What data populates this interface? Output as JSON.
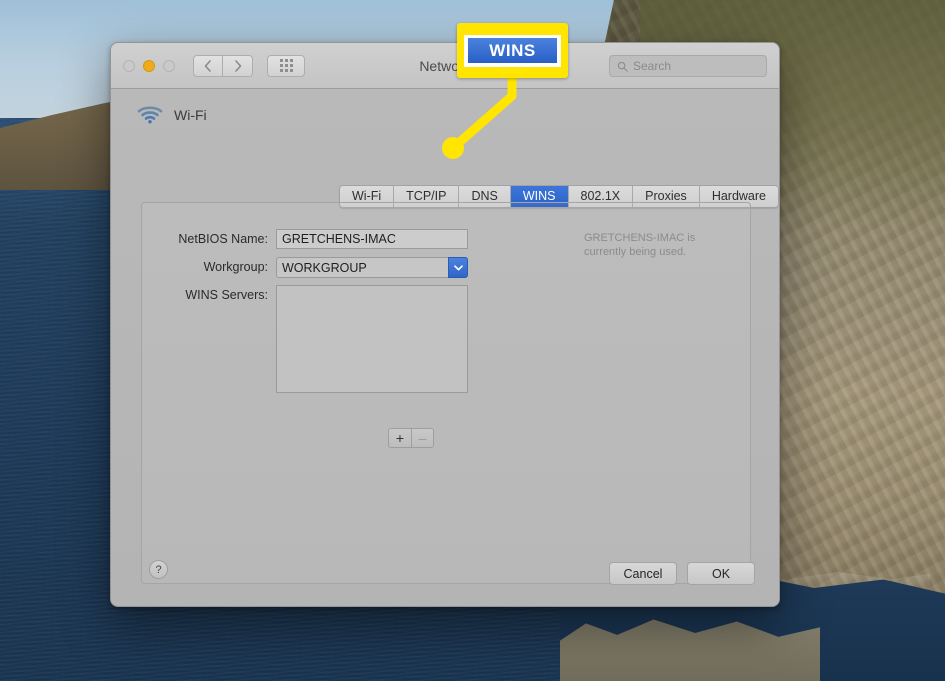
{
  "desktop": {
    "name": "macos-desktop-wallpaper"
  },
  "window": {
    "title": "Network",
    "traffic_lights": [
      {
        "name": "close",
        "state": "inactive",
        "color": "#c9c9c9"
      },
      {
        "name": "minimize",
        "state": "active",
        "color": "#f0ab1d"
      },
      {
        "name": "zoom",
        "state": "inactive",
        "color": "#c9c9c9"
      }
    ],
    "nav": {
      "back_label": "‹",
      "forward_label": "›"
    },
    "search": {
      "placeholder": "Search",
      "value": ""
    },
    "device": {
      "label": "Wi-Fi",
      "icon": "wifi-icon"
    }
  },
  "tabs": [
    {
      "label": "Wi-Fi",
      "active": false
    },
    {
      "label": "TCP/IP",
      "active": false
    },
    {
      "label": "DNS",
      "active": false
    },
    {
      "label": "WINS",
      "active": true
    },
    {
      "label": "802.1X",
      "active": false
    },
    {
      "label": "Proxies",
      "active": false
    },
    {
      "label": "Hardware",
      "active": false
    }
  ],
  "form": {
    "netbios": {
      "label": "NetBIOS Name:",
      "value": "GRETCHENS-IMAC",
      "helper": "GRETCHENS-IMAC is currently being used."
    },
    "workgroup": {
      "label": "Workgroup:",
      "value": "WORKGROUP"
    },
    "wins_servers": {
      "label": "WINS Servers:",
      "items": [],
      "add_label": "+",
      "remove_label": "–"
    }
  },
  "footer": {
    "help_label": "?",
    "cancel_label": "Cancel",
    "ok_label": "OK"
  },
  "callout": {
    "label": "WINS",
    "badge_color": "#ffe500",
    "chip_color": "#2a5fc4",
    "pointer_target": "wins-tab"
  }
}
